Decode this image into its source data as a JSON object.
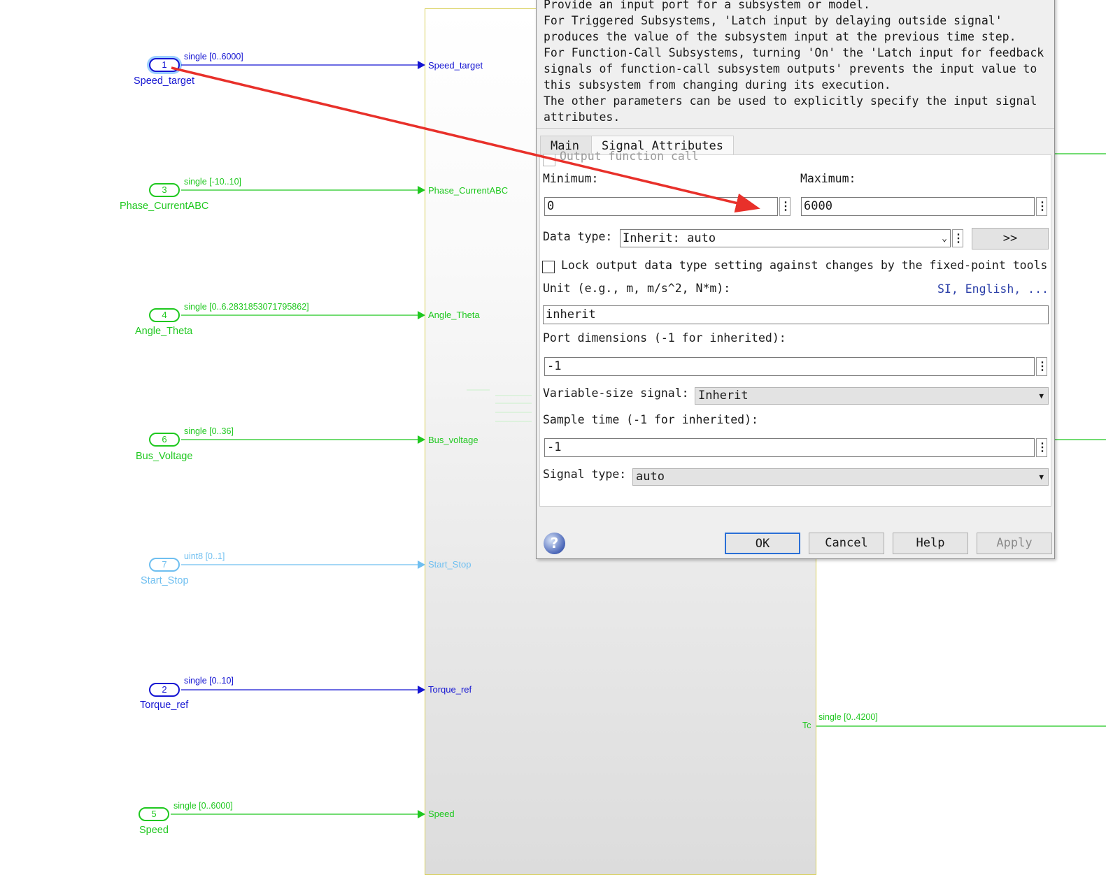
{
  "ports": [
    {
      "number": "1",
      "name": "Speed_target",
      "signal": "single [0..6000]",
      "input_label": "Speed_target",
      "color": "#1414d2",
      "selected": true
    },
    {
      "number": "3",
      "name": "Phase_CurrentABC",
      "signal": "single [-10..10]",
      "input_label": "Phase_CurrentABC",
      "color": "#1fc81f"
    },
    {
      "number": "4",
      "name": "Angle_Theta",
      "signal": "single [0..6.2831853071795862]",
      "input_label": "Angle_Theta",
      "color": "#1fc81f"
    },
    {
      "number": "6",
      "name": "Bus_Voltage",
      "signal": "single [0..36]",
      "input_label": "Bus_voltage",
      "color": "#1fc81f"
    },
    {
      "number": "7",
      "name": "Start_Stop",
      "signal": "uint8 [0..1]",
      "input_label": "Start_Stop",
      "color": "#6fbff0"
    },
    {
      "number": "2",
      "name": "Torque_ref",
      "signal": "single [0..10]",
      "input_label": "Torque_ref",
      "color": "#1414d2"
    },
    {
      "number": "5",
      "name": "Speed",
      "signal": "single [0..6000]",
      "input_label": "Speed",
      "color": "#1fc81f"
    }
  ],
  "output": {
    "port_label": "Tc",
    "signal": "single [0..4200]",
    "color": "#1fc81f"
  },
  "annotation": {
    "arrow_color": "#e8302a"
  },
  "dialog": {
    "description": "Provide an input port for a subsystem or model.\nFor Triggered Subsystems, 'Latch input by delaying outside signal'\nproduces the value of the subsystem input at the previous time step.\nFor Function-Call Subsystems, turning 'On' the 'Latch input for feedback\nsignals of function-call subsystem outputs' prevents the input value to\nthis subsystem from changing during its execution.\nThe other parameters can be used to explicitly specify the input signal\nattributes.",
    "tabs": {
      "main": "Main",
      "signal_attributes": "Signal Attributes"
    },
    "output_function_call": "Output function call",
    "minimum_label": "Minimum:",
    "minimum_value": "0",
    "maximum_label": "Maximum:",
    "maximum_value": "6000",
    "data_type_label": "Data type:",
    "data_type_value": "Inherit: auto",
    "data_type_assistant": ">>",
    "lock_label": "Lock output data type setting against changes by the fixed-point tools",
    "unit_label": "Unit (e.g., m, m/s^2, N*m):",
    "unit_link": "SI, English, ...",
    "unit_value": "inherit",
    "port_dim_label": "Port dimensions (-1 for inherited):",
    "port_dim_value": "-1",
    "var_size_label": "Variable-size signal:",
    "var_size_value": "Inherit",
    "sample_time_label": "Sample time (-1 for inherited):",
    "sample_time_value": "-1",
    "signal_type_label": "Signal type:",
    "signal_type_value": "auto",
    "buttons": {
      "ok": "OK",
      "cancel": "Cancel",
      "help": "Help",
      "apply": "Apply"
    },
    "help_icon": "question-mark-icon",
    "colors": {
      "link": "#2b3fa8",
      "ok_border": "#2a6fd6",
      "disabled_text": "#8a8a8a"
    }
  }
}
